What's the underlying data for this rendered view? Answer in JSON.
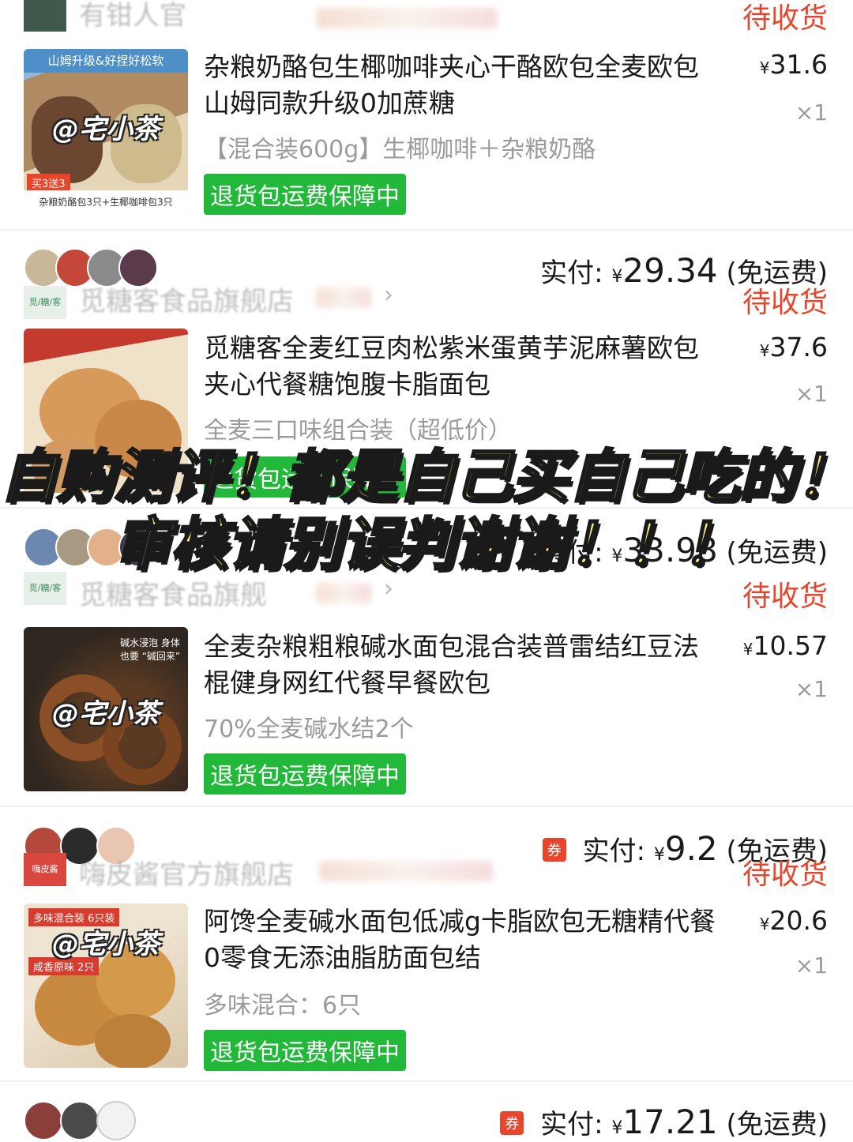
{
  "overlay": {
    "line1": "自购测评！都是自己买自己吃的！",
    "line2": "审核请别误判谢谢！！！"
  },
  "watermark": "@宅小茶",
  "colors": {
    "status": "#e8452c",
    "badge": "#22b83a",
    "overlay_text": "#fff37a"
  },
  "orders": [
    {
      "shop_name": "有钳人官",
      "status": "待收货",
      "item": {
        "title": "杂粮奶酪包生椰咖啡夹心干酪欧包全麦欧包山姆同款升级0加蔗糖",
        "spec": "【混合装600g】生椰咖啡＋杂粮奶酪",
        "badge": "退货包运费保障中",
        "price_symbol": "¥",
        "price": "31.6",
        "qty": "×1",
        "img_top": "山姆升级&好捏好松软",
        "img_tag": "买3送3",
        "img_caption": "杂粮奶酪包3只+生椰咖啡包3只"
      }
    },
    {
      "shop_name": "觅糖客食品旗舰店",
      "status": "待收货",
      "pay_label": "实付:",
      "pay_symbol": "¥",
      "pay_amount": "29.34",
      "pay_note": "(免运费)",
      "shop_logo_text": "觅/糖/客",
      "item": {
        "title": "觅糖客全麦红豆肉松紫米蛋黄芋泥麻薯欧包夹心代餐糖饱腹卡脂面包",
        "spec": "全麦三口味组合装（超低价）",
        "badge": "退货包运费保障中",
        "price_symbol": "¥",
        "price": "37.6",
        "qty": "×1"
      }
    },
    {
      "shop_name": "觅糖客食品旗舰",
      "status": "待收货",
      "pay_label": "实付:",
      "pay_symbol": "¥",
      "pay_amount": "33.98",
      "pay_note": "(免运费)",
      "shop_logo_text": "觅/糖/客",
      "item": {
        "title": "全麦杂粮粗粮碱水面包混合装普雷结红豆法棍健身网红代餐早餐欧包",
        "spec": "70%全麦碱水结2个",
        "badge": "退货包运费保障中",
        "price_symbol": "¥",
        "price": "10.57",
        "qty": "×1",
        "img_text": "碱水浸泡 身体也要 “碱回来”"
      }
    },
    {
      "shop_name": "嗨皮酱官方旗舰店",
      "status": "待收货",
      "coupon": "券",
      "pay_label": "实付:",
      "pay_symbol": "¥",
      "pay_amount": "9.2",
      "pay_note": "(免运费)",
      "shop_logo_text": "嗨皮酱",
      "item": {
        "title": "阿馋全麦碱水面包低减g卡脂欧包无糖精代餐0零食无添油脂肪面包结",
        "spec": "多味混合：6只",
        "badge": "退货包运费保障中",
        "price_symbol": "¥",
        "price": "20.6",
        "qty": "×1",
        "img_tag": "多味混合装 6只装",
        "img_tag2": "咸香原味 2只"
      }
    },
    {
      "coupon": "券",
      "pay_label": "实付:",
      "pay_symbol": "¥",
      "pay_amount": "17.21",
      "pay_note": "(免运费)"
    }
  ]
}
